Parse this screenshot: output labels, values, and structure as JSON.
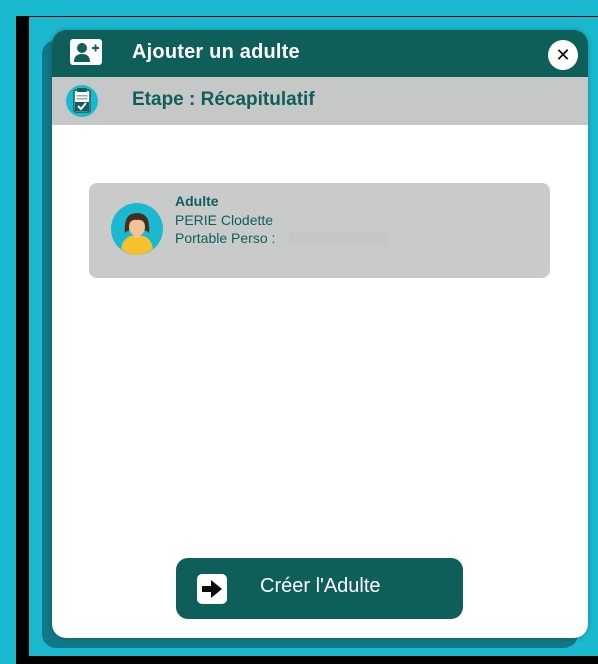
{
  "dialog": {
    "title": "Ajouter un adulte",
    "step": "Etape : Récapitulatif",
    "close_icon": "close-icon",
    "header_icon": "add-user-icon",
    "step_icon": "checklist-icon"
  },
  "card": {
    "role": "Adulte",
    "name": "PERIE Clodette",
    "phone_label": "Portable Perso :",
    "avatar_icon": "female-avatar-icon"
  },
  "actions": {
    "create_label": "Créer l'Adulte",
    "create_icon": "arrow-right-icon"
  },
  "colors": {
    "accent": "#0e5e5a",
    "background": "#1ab9cf",
    "step_bar": "#c6c8c8",
    "card": "#c9cbcb"
  }
}
